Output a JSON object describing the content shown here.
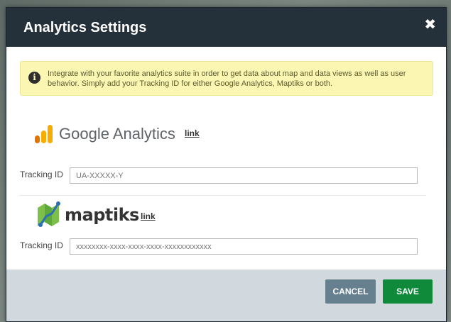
{
  "dialog": {
    "title": "Analytics Settings",
    "close_glyph": "✖"
  },
  "info": {
    "icon": "info-icon",
    "text": "Integrate with your favorite analytics suite in order to get data about map and data views as well as user behavior. Simply add your Tracking ID for either Google Analytics, Maptiks or both."
  },
  "google_analytics": {
    "logo_text": "Google Analytics",
    "link_text": "link",
    "tracking_label": "Tracking ID",
    "tracking_value": "",
    "tracking_placeholder": "UA-XXXXX-Y"
  },
  "maptiks": {
    "logo_text": "maptiks",
    "link_text": "link",
    "tracking_label": "Tracking ID",
    "tracking_value": "",
    "tracking_placeholder": "xxxxxxxx-xxxx-xxxx-xxxx-xxxxxxxxxxxx"
  },
  "footer": {
    "cancel_label": "CANCEL",
    "save_label": "SAVE"
  },
  "colors": {
    "header": "#25313a",
    "info_bg": "#fbf7b3",
    "cancel": "#66808f",
    "save": "#0f8a3b",
    "ga_orange": "#f9ab00",
    "ga_dark_orange": "#e37400",
    "maptiks_green": "#7cc04b",
    "maptiks_blue": "#2a6fb6"
  }
}
